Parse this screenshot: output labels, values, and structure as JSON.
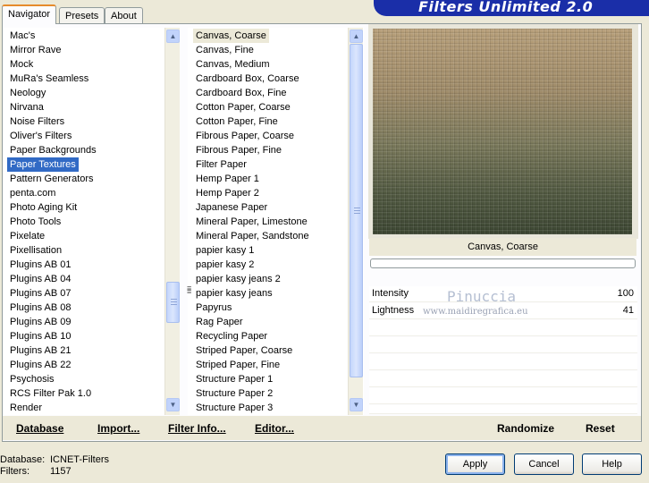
{
  "app": {
    "title": "Filters Unlimited 2.0"
  },
  "tabs": [
    {
      "label": "Navigator"
    },
    {
      "label": "Presets"
    },
    {
      "label": "About"
    }
  ],
  "categories": {
    "items": [
      "Mac's",
      "Mirror Rave",
      "Mock",
      "MuRa's Seamless",
      "Neology",
      "Nirvana",
      "Noise Filters",
      "Oliver's Filters",
      "Paper Backgrounds",
      "Paper Textures",
      "Pattern Generators",
      "penta.com",
      "Photo Aging Kit",
      "Photo Tools",
      "Pixelate",
      "Pixellisation",
      "Plugins AB 01",
      "Plugins AB 04",
      "Plugins AB 07",
      "Plugins AB 08",
      "Plugins AB 09",
      "Plugins AB 10",
      "Plugins AB 21",
      "Plugins AB 22",
      "Psychosis",
      "RCS Filter Pak 1.0",
      "Render"
    ],
    "selected": "Paper Textures"
  },
  "filters": {
    "items": [
      "Canvas, Coarse",
      "Canvas, Fine",
      "Canvas, Medium",
      "Cardboard Box, Coarse",
      "Cardboard Box, Fine",
      "Cotton Paper, Coarse",
      "Cotton Paper, Fine",
      "Fibrous Paper, Coarse",
      "Fibrous Paper, Fine",
      "Filter Paper",
      "Hemp Paper 1",
      "Hemp Paper 2",
      "Japanese Paper",
      "Mineral Paper, Limestone",
      "Mineral Paper, Sandstone",
      "papier kasy 1",
      "papier kasy 2",
      "papier kasy jeans 2",
      "papier kasy jeans",
      "Papyrus",
      "Rag Paper",
      "Recycling Paper",
      "Striped Paper, Coarse",
      "Striped Paper, Fine",
      "Structure Paper 1",
      "Structure Paper 2",
      "Structure Paper 3"
    ],
    "selected": "Canvas, Coarse"
  },
  "preview": {
    "filter_name": "Canvas, Coarse"
  },
  "controls": [
    {
      "label": "Intensity",
      "value": "100"
    },
    {
      "label": "Lightness",
      "value": "41"
    }
  ],
  "watermark": {
    "name": "Pinuccia",
    "site": "www.maidiregrafica.eu"
  },
  "toolbar": {
    "database": "Database",
    "import": "Import...",
    "filter_info": "Filter Info...",
    "editor": "Editor...",
    "randomize": "Randomize",
    "reset": "Reset"
  },
  "status": {
    "database_label": "Database:",
    "database_value": "ICNET-Filters",
    "filters_label": "Filters:",
    "filters_value": "1157"
  },
  "buttons": {
    "apply": "Apply",
    "cancel": "Cancel",
    "help": "Help"
  },
  "colors": {
    "accent": "#316ac5",
    "brand": "#1a2ea8",
    "tab_highlight": "#e68b2c"
  },
  "icons": {
    "scroll_up": "▲",
    "scroll_down": "▼"
  }
}
